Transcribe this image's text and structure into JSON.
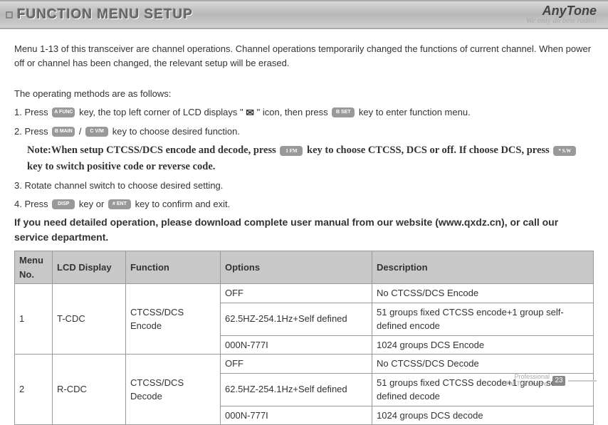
{
  "header": {
    "title": "FUNCTION MENU SETUP",
    "brand_name": "AnyTone",
    "brand_tag": "We only do best radio!"
  },
  "intro": "Menu 1-13 of this transceiver are channel operations. Channel operations temporarily changed the functions of current channel. When power off or channel has been changed, the relevant setup will be erased.",
  "methods_title": "The operating methods are as follows:",
  "step1_a": "1. Press ",
  "step1_b": " key, the top left corner of LCD displays \" ",
  "step1_c": " \" icon, then press ",
  "step1_d": " key to enter function menu.",
  "step2_a": "2. Press ",
  "step2_b": " / ",
  "step2_c": " key to choose desired function.",
  "note_a": "Note:When setup CTCSS/DCS encode and decode, press ",
  "note_b": " key to choose CTCSS, DCS or off. If choose DCS, press ",
  "note_c": " key to switch positive code or reverse code.",
  "step3": "3. Rotate channel switch to choose desired setting.",
  "step4_a": "4. Press ",
  "step4_b": " key or ",
  "step4_c": " key to confirm and exit.",
  "bold_note": "If you need detailed operation, please download complete user manual from our website (www.qxdz.cn), or call our service department.",
  "keys": {
    "afunc": "A FUNC",
    "bset": "B SET",
    "bmain": "B MAIN",
    "cvm": "C V/M",
    "fm": "1 FM",
    "sw": "* S.W",
    "disp": "DISP",
    "ent": "# ENT"
  },
  "envelope": "✉",
  "table": {
    "headers": {
      "no": "Menu No.",
      "lcd": "LCD Display",
      "func": "Function",
      "opt": "Options",
      "desc": "Description"
    },
    "rows": [
      {
        "no": "1",
        "lcd": "T-CDC",
        "func": "CTCSS/DCS Encode",
        "sub": [
          {
            "opt": "OFF",
            "desc": "No CTCSS/DCS Encode"
          },
          {
            "opt": "62.5HZ-254.1Hz+Self defined",
            "desc": "51 groups fixed CTCSS encode+1 group self-defined encode"
          },
          {
            "opt": "000N-777I",
            "desc": "1024 groups DCS Encode"
          }
        ]
      },
      {
        "no": "2",
        "lcd": "R-CDC",
        "func": "CTCSS/DCS Decode",
        "sub": [
          {
            "opt": "OFF",
            "desc": "No CTCSS/DCS Decode"
          },
          {
            "opt": "62.5HZ-254.1Hz+Self defined",
            "desc": "51 groups fixed CTCSS decode+1 group self-defined decode"
          },
          {
            "opt": "000N-777I",
            "desc": "1024 groups DCS decode"
          }
        ]
      }
    ]
  },
  "footer": {
    "line1": "Professional",
    "line2": "FM Transceiver",
    "page": "23"
  }
}
